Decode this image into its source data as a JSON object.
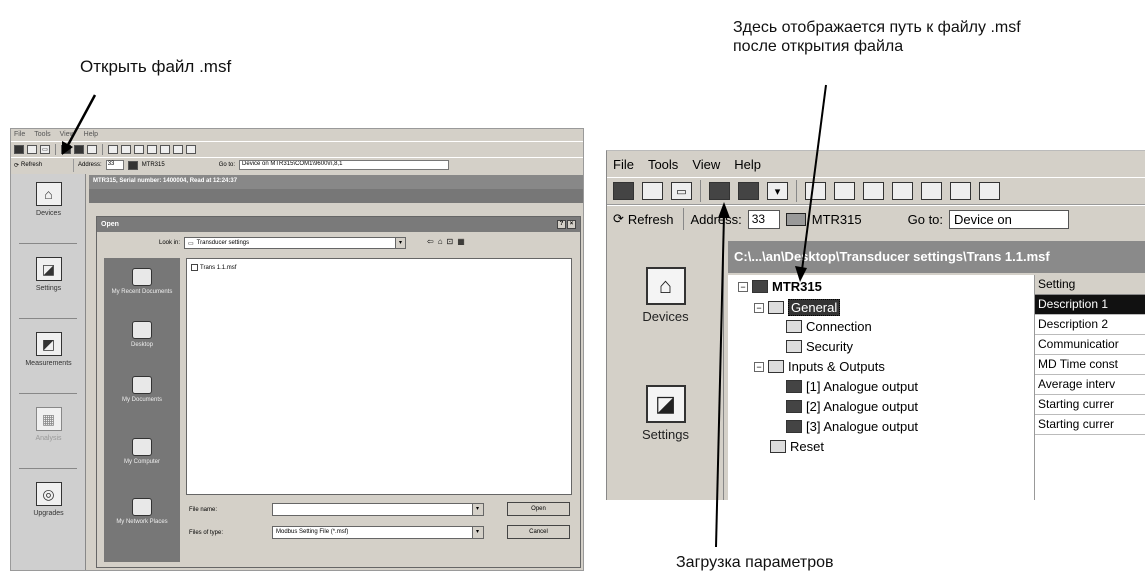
{
  "annotations": {
    "open_file": "Открыть файл .msf",
    "path_line1": "Здесь отображается путь к файлу .msf",
    "path_line2": "после открытия файла",
    "load_params": "Загрузка параметров"
  },
  "left_window": {
    "menu": [
      "File",
      "Tools",
      "View",
      "Help"
    ],
    "refresh_label": "Refresh",
    "address_label": "Address:",
    "address_value": "33",
    "device_name": "MTR315",
    "goto_label": "Go to:",
    "goto_value": "Device on MTR315\\COM1\\9600\\n,8,1",
    "header": "MTR315, Serial number: 1400004, Read at 12:24:37",
    "nav": [
      "Devices",
      "Settings",
      "Measurements",
      "Analysis",
      "Upgrades"
    ],
    "dialog": {
      "title": "Open",
      "look_in_label": "Look in:",
      "look_in_value": "Transducer settings",
      "places": [
        "My Recent Documents",
        "Desktop",
        "My Documents",
        "My Computer",
        "My Network Places"
      ],
      "files": [
        "Trans 1.1.msf"
      ],
      "file_name_label": "File name:",
      "file_name_value": "",
      "file_type_label": "Files of type:",
      "file_type_value": "Modbus Setting File (*.msf)",
      "open_button": "Open",
      "cancel_button": "Cancel",
      "help_button": "?",
      "close_button": "×"
    }
  },
  "right_window": {
    "menu": [
      "File",
      "Tools",
      "View",
      "Help"
    ],
    "refresh_label": "Refresh",
    "address_label": "Address:",
    "address_value": "33",
    "device_name": "MTR315",
    "goto_label": "Go to:",
    "goto_value": "Device on",
    "path": "C:\\...\\an\\Desktop\\Transducer settings\\Trans 1.1.msf",
    "nav": [
      "Devices",
      "Settings"
    ],
    "tree": {
      "root": "MTR315",
      "general": "General",
      "connection": "Connection",
      "security": "Security",
      "inputs_outputs": "Inputs & Outputs",
      "out1": "[1] Analogue output",
      "out2": "[2] Analogue output",
      "out3": "[3] Analogue output",
      "reset": "Reset"
    },
    "grid_header": "Setting",
    "grid_rows": [
      "Description 1",
      "Description 2",
      "Communicatior",
      "MD Time const",
      "Average interv",
      "Starting currer",
      "Starting currer"
    ]
  }
}
